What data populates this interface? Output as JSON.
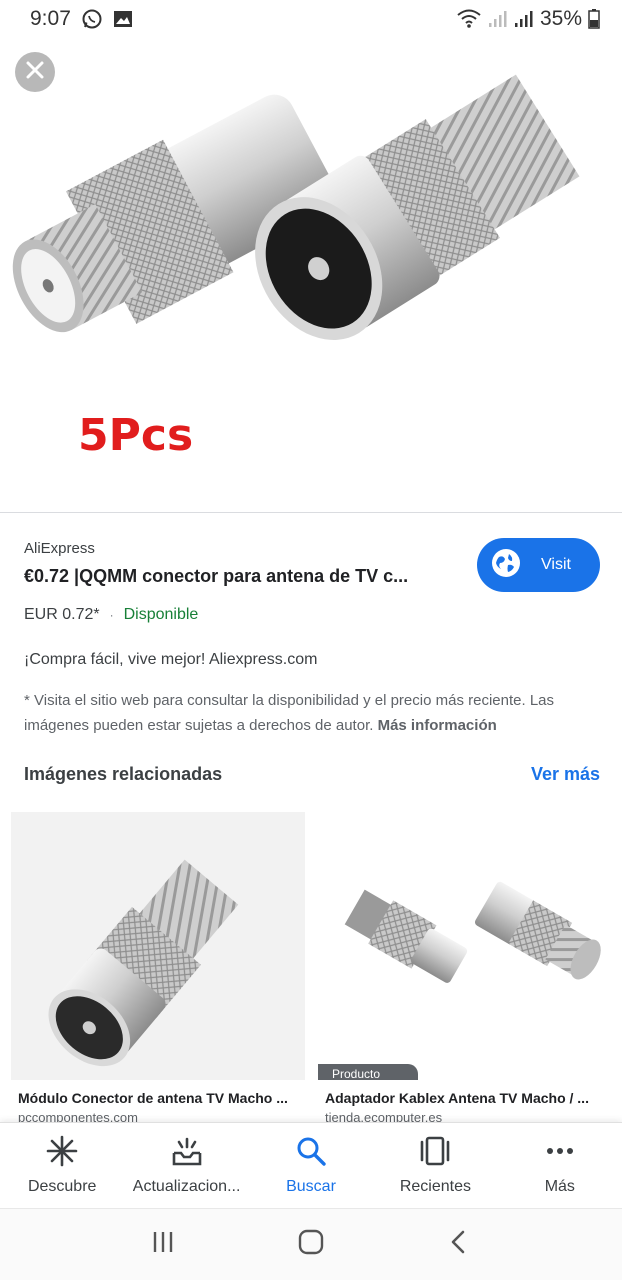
{
  "status_bar": {
    "time": "9:07",
    "battery": "35%",
    "icons": [
      "whatsapp-icon",
      "gallery-icon",
      "wifi-icon",
      "signal-icon",
      "signal-icon",
      "battery-icon"
    ]
  },
  "hero": {
    "close_icon": "close-icon",
    "overlay_text": "5Pcs"
  },
  "result": {
    "source": "AliExpress",
    "title": "€0.72 |QQMM conector para antena de TV c...",
    "visit_label": "Visit",
    "price": "EUR 0.72*",
    "separator": "·",
    "availability": "Disponible",
    "slogan": "¡Compra fácil, vive mejor! Aliexpress.com",
    "disclaimer": "* Visita el sitio web para consultar la disponibilidad y el precio más reciente. Las imágenes pueden estar sujetas a derechos de autor.",
    "more_info": "Más información"
  },
  "related": {
    "heading": "Imágenes relacionadas",
    "see_more": "Ver más",
    "items": [
      {
        "title": "Módulo Conector de antena TV Macho ...",
        "site": "pccomponentes.com"
      },
      {
        "title": "Adaptador Kablex Antena TV Macho / ...",
        "site": "tienda.ecomputer.es",
        "badge": "Producto"
      }
    ]
  },
  "bottom_nav": {
    "items": [
      {
        "label": "Descubre",
        "icon": "asterisk-icon"
      },
      {
        "label": "Actualizacion...",
        "icon": "updates-icon"
      },
      {
        "label": "Buscar",
        "icon": "search-icon",
        "active": true
      },
      {
        "label": "Recientes",
        "icon": "recents-icon"
      },
      {
        "label": "Más",
        "icon": "more-icon"
      }
    ]
  },
  "colors": {
    "accent": "#1a73e8",
    "available": "#188038",
    "promo_red": "#e11d1d"
  }
}
